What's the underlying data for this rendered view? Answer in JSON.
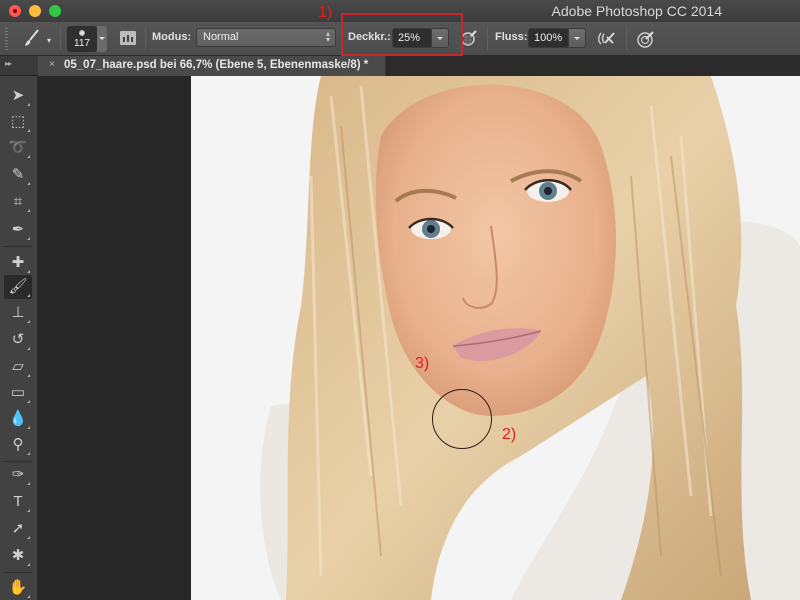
{
  "window": {
    "app_title": "Adobe Photoshop CC 2014",
    "traffic_lights": [
      "close",
      "minimize",
      "maximize"
    ]
  },
  "options_bar": {
    "tool_icon": "brush-icon",
    "brush_size": "117",
    "modus_label": "Modus:",
    "modus_value": "Normal",
    "opacity_label": "Deckkr.:",
    "opacity_value": "25%",
    "flow_label": "Fluss:",
    "flow_value": "100%",
    "icons": [
      "brush-panel-toggle-icon",
      "pressure-opacity-icon",
      "airbrush-icon",
      "pressure-size-icon"
    ]
  },
  "document": {
    "tab_close": "×",
    "tab_title": "05_07_haare.psd bei 66,7% (Ebene 5, Ebenenmaske/8) *"
  },
  "annotations": {
    "a1": "1)",
    "a2": "2)",
    "a3": "3)",
    "highlight_color": "#c9262b"
  },
  "toolbar": {
    "panel_collapse": "▸▸",
    "tools": [
      {
        "name": "move-tool",
        "glyph": "➤"
      },
      {
        "name": "marquee-tool",
        "glyph": "⬚"
      },
      {
        "name": "lasso-tool",
        "glyph": "➰"
      },
      {
        "name": "quick-selection-tool",
        "glyph": "✎"
      },
      {
        "name": "crop-tool",
        "glyph": "⌗"
      },
      {
        "name": "eyedropper-tool",
        "glyph": "✒"
      },
      {
        "name": "healing-brush-tool",
        "glyph": "✚"
      },
      {
        "name": "brush-tool",
        "glyph": "🖌"
      },
      {
        "name": "clone-stamp-tool",
        "glyph": "⊥"
      },
      {
        "name": "history-brush-tool",
        "glyph": "↺"
      },
      {
        "name": "eraser-tool",
        "glyph": "▱"
      },
      {
        "name": "gradient-tool",
        "glyph": "▭"
      },
      {
        "name": "blur-tool",
        "glyph": "💧"
      },
      {
        "name": "dodge-tool",
        "glyph": "⚲"
      },
      {
        "name": "pen-tool",
        "glyph": "✑"
      },
      {
        "name": "type-tool",
        "glyph": "T"
      },
      {
        "name": "path-selection-tool",
        "glyph": "➚"
      },
      {
        "name": "custom-shape-tool",
        "glyph": "✱"
      },
      {
        "name": "hand-tool",
        "glyph": "✋"
      }
    ]
  }
}
